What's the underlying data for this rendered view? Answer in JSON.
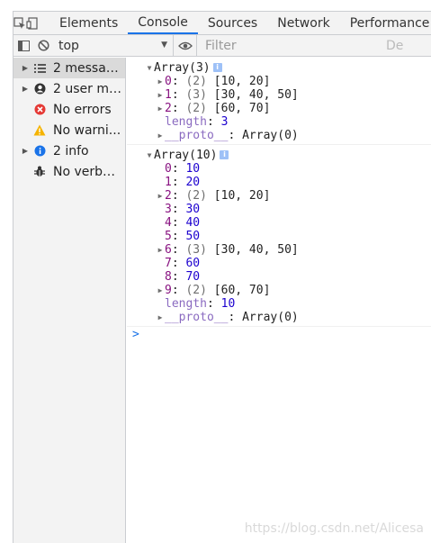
{
  "tabs": {
    "elements": "Elements",
    "console": "Console",
    "sources": "Sources",
    "network": "Network",
    "performance": "Performance"
  },
  "toolbar": {
    "context": "top",
    "filter_placeholder": "Filter",
    "more": "De"
  },
  "sidebar": {
    "items": [
      {
        "label": "2 messag..."
      },
      {
        "label": "2 user me..."
      },
      {
        "label": "No errors"
      },
      {
        "label": "No warni..."
      },
      {
        "label": "2 info"
      },
      {
        "label": "No verbo..."
      }
    ]
  },
  "messages": [
    {
      "header": "Array(3)",
      "rows": [
        {
          "key": "0",
          "count": "(2)",
          "value": "[10, 20]"
        },
        {
          "key": "1",
          "count": "(3)",
          "value": "[30, 40, 50]"
        },
        {
          "key": "2",
          "count": "(2)",
          "value": "[60, 70]"
        }
      ],
      "length_key": "length",
      "length_value": "3",
      "proto_key": "__proto__",
      "proto_value": "Array(0)"
    },
    {
      "header": "Array(10)",
      "rows": [
        {
          "key": "0",
          "value": "10"
        },
        {
          "key": "1",
          "value": "20"
        },
        {
          "key": "2",
          "count": "(2)",
          "value": "[10, 20]"
        },
        {
          "key": "3",
          "value": "30"
        },
        {
          "key": "4",
          "value": "40"
        },
        {
          "key": "5",
          "value": "50"
        },
        {
          "key": "6",
          "count": "(3)",
          "value": "[30, 40, 50]"
        },
        {
          "key": "7",
          "value": "60"
        },
        {
          "key": "8",
          "value": "70"
        },
        {
          "key": "9",
          "count": "(2)",
          "value": "[60, 70]"
        }
      ],
      "length_key": "length",
      "length_value": "10",
      "proto_key": "__proto__",
      "proto_value": "Array(0)"
    }
  ],
  "prompt": ">",
  "watermark": "https://blog.csdn.net/Alicesa",
  "colors": {
    "accent": "#1a73e8",
    "error": "#e53935",
    "warning": "#f5b300",
    "info": "#1a73e8",
    "property": "#881280",
    "number": "#1c00cf"
  }
}
